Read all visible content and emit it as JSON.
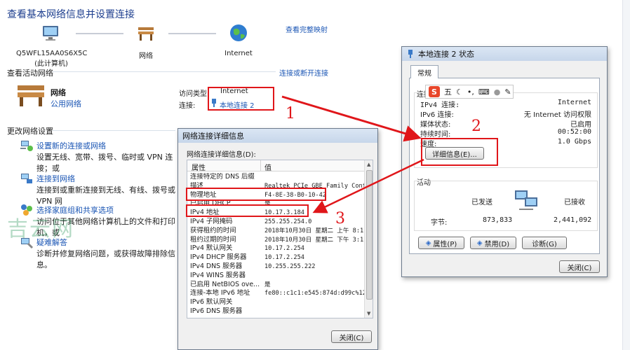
{
  "page": {
    "title": "查看基本网络信息并设置连接",
    "view_full_map": "查看完整映射",
    "nodes": [
      {
        "label": "Q5WFL15AA0S6X5C",
        "sub": "(此计算机)"
      },
      {
        "label": "网络",
        "sub": ""
      },
      {
        "label": "Internet",
        "sub": ""
      }
    ],
    "active_head": "查看活动网络",
    "connect_disconnect": "连接或断开连接",
    "active_network": {
      "name": "网络",
      "type": "公用网络"
    },
    "access_type_label": "访问类型:",
    "access_type_value": "Internet",
    "connections_label": "连接:",
    "connections_value": "本地连接 2",
    "change_head": "更改网络设置",
    "tasks": [
      {
        "title": "设置新的连接或网络",
        "desc": "设置无线、宽带、拨号、临时或 VPN 连接；或"
      },
      {
        "title": "连接到网络",
        "desc": "连接到或重新连接到无线、有线、拨号或 VPN 网"
      },
      {
        "title": "选择家庭组和共享选项",
        "desc": "访问位于其他网络计算机上的文件和打印机，或"
      },
      {
        "title": "疑难解答",
        "desc": "诊断并修复网络问题，或获得故障排除信息。"
      }
    ]
  },
  "status_dialog": {
    "title": "本地连接 2 状态",
    "tab": "常规",
    "conn_label": "连接",
    "rows": [
      {
        "k": "IPv4 连接:",
        "v": "Internet"
      },
      {
        "k": "IPv6 连接:",
        "v": "无 Internet 访问权限"
      },
      {
        "k": "媒体状态:",
        "v": "已启用"
      },
      {
        "k": "持续时间:",
        "v": "00:52:00"
      },
      {
        "k": "速度:",
        "v": "1.0 Gbps"
      }
    ],
    "details_button": "详细信息(E)...",
    "activity_label": "活动",
    "sent_label": "已发送",
    "received_label": "已接收",
    "bytes_label": "字节:",
    "bytes_sent": "873,833",
    "bytes_received": "2,441,092",
    "properties_button": "属性(P)",
    "disable_button": "禁用(D)",
    "diagnose_button": "诊断(G)",
    "close_button": "关闭(C)"
  },
  "details_dialog": {
    "title": "网络连接详细信息",
    "label": "网络连接详细信息(D):",
    "col_property": "属性",
    "col_value": "值",
    "rows": [
      {
        "p": "连接特定的 DNS 后缀",
        "v": ""
      },
      {
        "p": "描述",
        "v": "Realtek PCIe GBE Family Contro"
      },
      {
        "p": "物理地址",
        "v": "F4-8E-38-B0-10-42"
      },
      {
        "p": "已启用 DHCP",
        "v": "是"
      },
      {
        "p": "IPv4 地址",
        "v": "10.17.3.184"
      },
      {
        "p": "IPv4 子网掩码",
        "v": "255.255.254.0"
      },
      {
        "p": "获得租约的时间",
        "v": "2018年10月30日 星期二 上午 8:1"
      },
      {
        "p": "租约过期的时间",
        "v": "2018年10月30日 星期二 下午 3:1"
      },
      {
        "p": "IPv4 默认网关",
        "v": "10.17.2.254"
      },
      {
        "p": "IPv4 DHCP 服务器",
        "v": "10.17.2.254"
      },
      {
        "p": "IPv4 DNS 服务器",
        "v": "10.255.255.222"
      },
      {
        "p": "IPv4 WINS 服务器",
        "v": ""
      },
      {
        "p": "已启用 NetBIOS ove...",
        "v": "是"
      },
      {
        "p": "连接-本地 IPv6 地址",
        "v": "fe80::c1c1:e545:874d:d99c%12"
      },
      {
        "p": "IPv6 默认网关",
        "v": ""
      },
      {
        "p": "IPv6 DNS 服务器",
        "v": ""
      }
    ],
    "close_button": "关闭(C)"
  },
  "ime_toolbar": {
    "brand": "S",
    "mode": "五"
  },
  "annotations": {
    "one": "1",
    "two": "2",
    "three": "3"
  },
  "watermark": "吉云网",
  "colors": {
    "annotation": "#e0161a",
    "link": "#1a55b4",
    "title": "#1e3f8f"
  }
}
